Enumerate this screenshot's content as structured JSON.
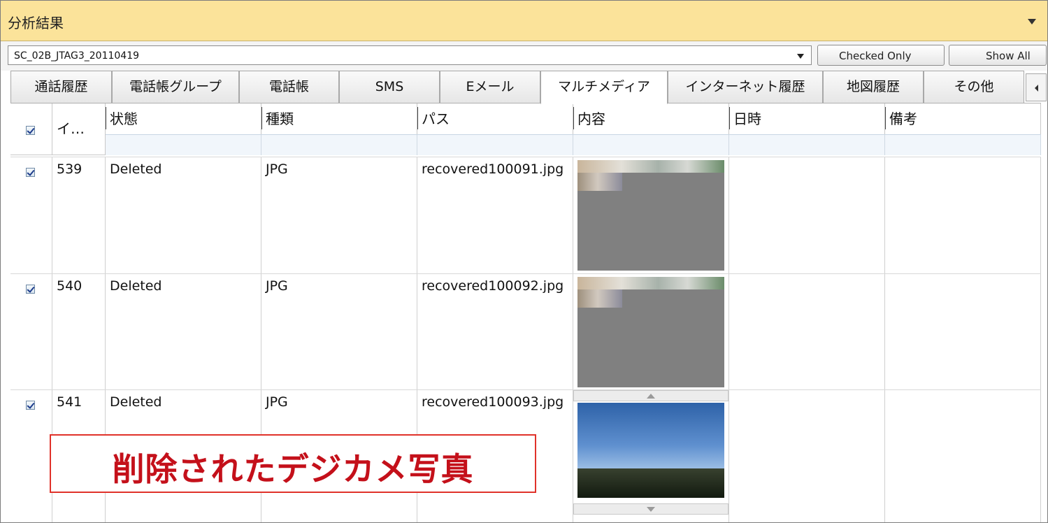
{
  "panel": {
    "title": "分析結果"
  },
  "toolbar": {
    "selected_source": "SC_02B_JTAG3_20110419",
    "checked_only_label": "Checked Only",
    "show_all_label": "Show All"
  },
  "tabs": [
    {
      "label": "通話履歴"
    },
    {
      "label": "電話帳グループ"
    },
    {
      "label": "電話帳"
    },
    {
      "label": "SMS"
    },
    {
      "label": "Eメール"
    },
    {
      "label": "マルチメディア",
      "active": true
    },
    {
      "label": "インターネット履歴"
    },
    {
      "label": "地図履歴"
    },
    {
      "label": "その他"
    }
  ],
  "grid": {
    "columns": {
      "index": "イ…",
      "status": "状態",
      "type": "種類",
      "path": "パス",
      "content": "内容",
      "datetime": "日時",
      "notes": "備考"
    },
    "header_checked": true,
    "rows": [
      {
        "checked": true,
        "index": "539",
        "status": "Deleted",
        "type": "JPG",
        "path": "recovered100091.jpg",
        "datetime": "",
        "notes": "",
        "thumbnail": "partial-corrupted-image"
      },
      {
        "checked": true,
        "index": "540",
        "status": "Deleted",
        "type": "JPG",
        "path": "recovered100092.jpg",
        "datetime": "",
        "notes": "",
        "thumbnail": "partial-corrupted-image"
      },
      {
        "checked": true,
        "index": "541",
        "status": "Deleted",
        "type": "JPG",
        "path": "recovered100093.jpg",
        "datetime": "",
        "notes": "",
        "thumbnail": "sky-landscape-image"
      }
    ]
  },
  "annotation": {
    "text": "削除されたデジカメ写真"
  },
  "colors": {
    "title_bar": "#fbe39a",
    "caption_text": "#c4101a",
    "caption_border": "#e0322a"
  }
}
